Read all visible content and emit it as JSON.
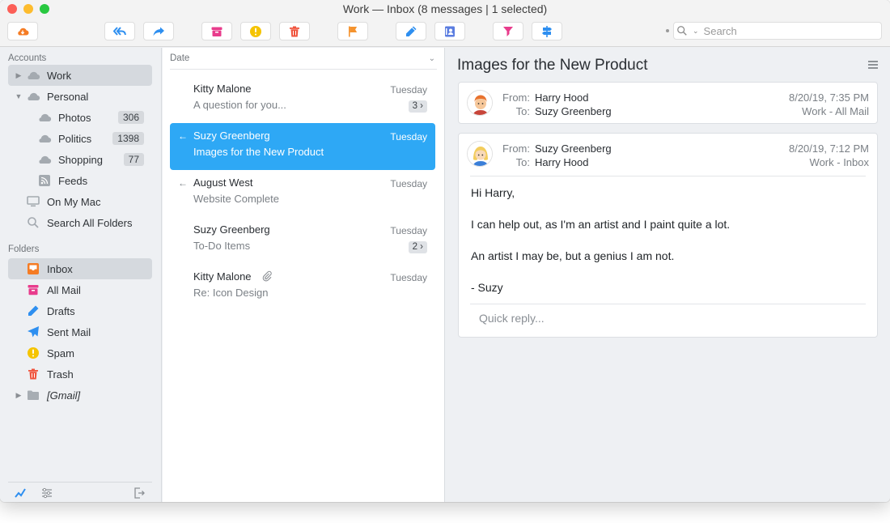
{
  "window": {
    "title": "Work — Inbox (8 messages | 1 selected)"
  },
  "toolbar": {
    "buttons": [
      {
        "name": "get-mail",
        "icon": "cloud-download-icon",
        "color": "#f57c24"
      },
      {
        "name": "reply-all",
        "icon": "reply-all-icon",
        "color": "#2e8ff0"
      },
      {
        "name": "forward",
        "icon": "forward-icon",
        "color": "#2e8ff0"
      },
      {
        "name": "archive",
        "icon": "archive-icon",
        "color": "#e83c8c"
      },
      {
        "name": "spam",
        "icon": "spam-icon",
        "color": "#f5c400"
      },
      {
        "name": "delete",
        "icon": "trash-icon",
        "color": "#f0533c"
      },
      {
        "name": "flag",
        "icon": "flag-icon",
        "color": "#f5932e"
      },
      {
        "name": "compose",
        "icon": "compose-icon",
        "color": "#2e8ff0"
      },
      {
        "name": "contacts",
        "icon": "contacts-icon",
        "color": "#5b7de0"
      },
      {
        "name": "filter",
        "icon": "funnel-icon",
        "color": "#e83c8c"
      },
      {
        "name": "move",
        "icon": "signpost-icon",
        "color": "#2e8ff0"
      }
    ],
    "search_placeholder": "Search"
  },
  "sidebar": {
    "accounts_header": "Accounts",
    "accounts": [
      {
        "label": "Work",
        "icon": "cloud-icon",
        "selected": true,
        "expand": "collapsed"
      },
      {
        "label": "Personal",
        "icon": "cloud-icon",
        "expand": "expanded"
      },
      {
        "label": "Photos",
        "icon": "cloud-icon",
        "badge": "306"
      },
      {
        "label": "Politics",
        "icon": "cloud-icon",
        "badge": "1398"
      },
      {
        "label": "Shopping",
        "icon": "cloud-icon",
        "badge": "77"
      },
      {
        "label": "Feeds",
        "icon": "rss-icon"
      },
      {
        "label": "On My Mac",
        "icon": "monitor-icon"
      },
      {
        "label": "Search All Folders",
        "icon": "search-icon"
      }
    ],
    "folders_header": "Folders",
    "folders": [
      {
        "label": "Inbox",
        "icon": "inbox-icon",
        "color": "#f57c24",
        "selected": true
      },
      {
        "label": "All Mail",
        "icon": "archive-icon",
        "color": "#e83c8c"
      },
      {
        "label": "Drafts",
        "icon": "pencil-icon",
        "color": "#2e8ff0"
      },
      {
        "label": "Sent Mail",
        "icon": "paper-plane-icon",
        "color": "#2e8ff0"
      },
      {
        "label": "Spam",
        "icon": "spam-icon",
        "color": "#f5c400"
      },
      {
        "label": "Trash",
        "icon": "trash-icon",
        "color": "#f0533c"
      },
      {
        "label": "[Gmail]",
        "icon": "folder-icon",
        "color": "#a7adb3"
      }
    ],
    "footer_icons": [
      "activity-icon",
      "sliders-icon",
      "sign-out-icon"
    ]
  },
  "message_list": {
    "sort_label": "Date",
    "messages": [
      {
        "from": "Kitty Malone",
        "subject": "A question for you...",
        "date": "Tuesday",
        "count": "3 ›",
        "replied": false
      },
      {
        "from": "Suzy Greenberg",
        "subject": "Images for the New Product",
        "date": "Tuesday",
        "replied": true,
        "selected": true
      },
      {
        "from": "August West",
        "subject": "Website Complete",
        "date": "Tuesday",
        "replied": true
      },
      {
        "from": "Suzy Greenberg",
        "subject": "To-Do Items",
        "date": "Tuesday",
        "count": "2 ›",
        "replied": false
      },
      {
        "from": "Kitty Malone",
        "subject": "Re: Icon Design",
        "date": "Tuesday",
        "attachment": true,
        "replied": false
      }
    ]
  },
  "reader": {
    "subject": "Images for the New Product",
    "labels": {
      "from": "From:",
      "to": "To:"
    },
    "messages": [
      {
        "from": "Harry Hood",
        "to": "Suzy Greenberg",
        "date": "8/20/19, 7:35 PM",
        "folder": "Work - All Mail"
      },
      {
        "from": "Suzy Greenberg",
        "to": "Harry Hood",
        "date": "8/20/19, 7:12 PM",
        "folder": "Work - Inbox",
        "body": [
          "Hi Harry,",
          "I can help out, as I'm an artist and I paint quite a lot.",
          "An artist I may be, but a genius I am not.",
          "- Suzy"
        ]
      }
    ],
    "quick_reply_placeholder": "Quick reply..."
  }
}
